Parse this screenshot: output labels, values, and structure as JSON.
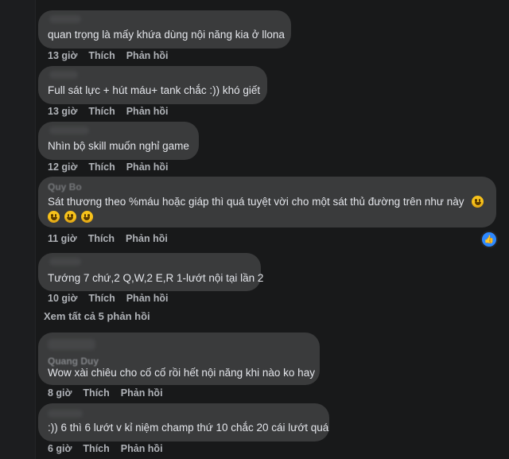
{
  "comments": [
    {
      "author": "",
      "text": "quan trọng là mấy khứa dùng nội năng kia ở llona",
      "time": "13 giờ",
      "like": "Thích",
      "reply": "Phản hồi"
    },
    {
      "author": "",
      "text": "Full sát lực + hút máu+ tank chắc :)) khó giết",
      "time": "13 giờ",
      "like": "Thích",
      "reply": "Phản hồi"
    },
    {
      "author": "",
      "text": "Nhìn bộ skill muốn nghỉ game",
      "time": "12 giờ",
      "like": "Thích",
      "reply": "Phản hồi"
    },
    {
      "author": "Quy Bo",
      "text": "Sát thương theo %máu hoặc giáp thì quá tuyệt vời cho một sát thủ đường trên như này",
      "time": "11 giờ",
      "like": "Thích",
      "reply": "Phản hồi"
    },
    {
      "author": "",
      "text": "Tướng 7 chứ,2 Q,W,2 E,R 1-lướt nội tại lần 2",
      "time": "10 giờ",
      "like": "Thích",
      "reply": "Phản hồi"
    },
    {
      "author": "Quang Duy",
      "text": "Wow xài chiêu cho cố cố rồi hết nội năng khi nào ko hay",
      "time": "8 giờ",
      "like": "Thích",
      "reply": "Phản hồi"
    },
    {
      "author": "",
      "text": ":)) 6 thì 6 lướt v kỉ niệm champ thứ 10 chắc 20 cái lướt quá",
      "time": "6 giờ",
      "like": "Thích",
      "reply": "Phản hồi"
    }
  ],
  "view_more": "Xem tất cả 5 phản hồi",
  "icons": {
    "emoji": "grinning-face-icon",
    "like_badge": "thumbs-up-icon"
  },
  "colors": {
    "background": "#18191a",
    "bubble": "#3a3b3c",
    "meta": "#b0b3b8",
    "like_badge": "#2d88ff"
  }
}
